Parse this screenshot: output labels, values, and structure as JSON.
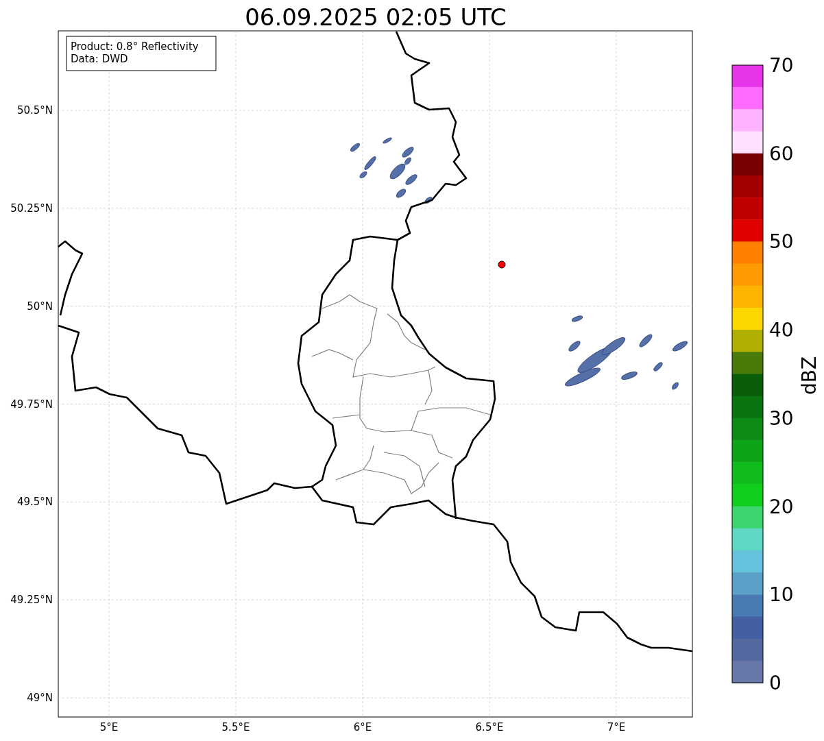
{
  "title": "06.09.2025 02:05 UTC",
  "legend": {
    "lines": [
      "Product: 0.8° Reflectivity",
      "Data: DWD"
    ]
  },
  "x_ticks": [
    "5°E",
    "5.5°E",
    "6°E",
    "6.5°E",
    "7°E"
  ],
  "y_ticks": [
    "50.5°N",
    "50.25°N",
    "50°N",
    "49.75°N",
    "49.5°N",
    "49.25°N",
    "49°N"
  ],
  "colorbar": {
    "label": "dBZ",
    "ticks": [
      "70",
      "60",
      "50",
      "40",
      "30",
      "20",
      "10",
      "0"
    ],
    "bins": [
      {
        "color": "#e835ea"
      },
      {
        "color": "#ff6bff"
      },
      {
        "color": "#ffb3ff"
      },
      {
        "color": "#ffe0ff"
      },
      {
        "color": "#780000"
      },
      {
        "color": "#a00000"
      },
      {
        "color": "#c00000"
      },
      {
        "color": "#e00000"
      },
      {
        "color": "#ff7f00"
      },
      {
        "color": "#ff9a00"
      },
      {
        "color": "#ffb400"
      },
      {
        "color": "#ffd700"
      },
      {
        "color": "#b0b000"
      },
      {
        "color": "#4a7a0a"
      },
      {
        "color": "#0a5e0a"
      },
      {
        "color": "#0a7510"
      },
      {
        "color": "#0c8c14"
      },
      {
        "color": "#0ea418"
      },
      {
        "color": "#10bc1c"
      },
      {
        "color": "#12ce1c"
      },
      {
        "color": "#3dd66e"
      },
      {
        "color": "#5fd9c4"
      },
      {
        "color": "#66c2dc"
      },
      {
        "color": "#5ba0c8"
      },
      {
        "color": "#4a7ab4"
      },
      {
        "color": "#4460a4"
      },
      {
        "color": "#5468a0"
      },
      {
        "color": "#6878aa"
      }
    ]
  }
}
